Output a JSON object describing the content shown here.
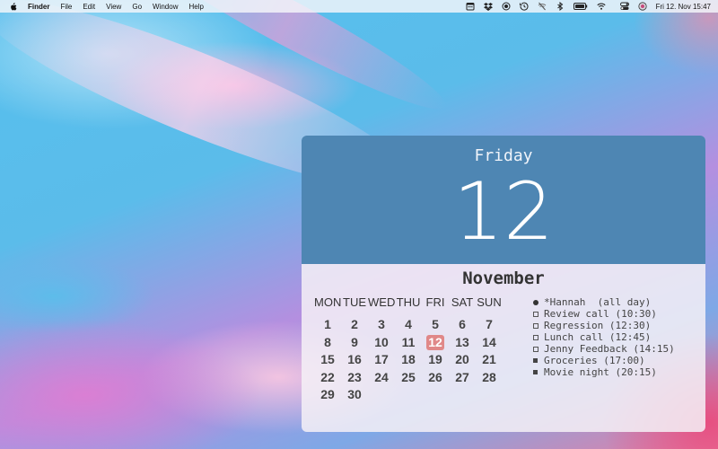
{
  "menubar": {
    "app_name": "Finder",
    "menus": [
      "File",
      "Edit",
      "View",
      "Go",
      "Window",
      "Help"
    ],
    "status_icons": [
      "calendar-icon",
      "dropbox-icon",
      "screen-record-icon",
      "time-machine-icon",
      "wifi-off-icon",
      "bluetooth-icon",
      "battery-icon",
      "wifi-icon",
      "control-center-icon",
      "siri-icon"
    ],
    "clock": "Fri 12. Nov  15:47"
  },
  "widget": {
    "day_name": "Friday",
    "day_number": "12",
    "month": "November",
    "weekdays": [
      "MON",
      "TUE",
      "WED",
      "THU",
      "FRI",
      "SAT",
      "SUN"
    ],
    "days": [
      "1",
      "2",
      "3",
      "4",
      "5",
      "6",
      "7",
      "8",
      "9",
      "10",
      "11",
      "12",
      "13",
      "14",
      "15",
      "16",
      "17",
      "18",
      "19",
      "20",
      "21",
      "22",
      "23",
      "24",
      "25",
      "26",
      "27",
      "28",
      "29",
      "30"
    ],
    "today": "12",
    "colors": {
      "header": "#4e86b3",
      "today": "#e08888"
    },
    "events": [
      {
        "text": "*Hannah  (all day)",
        "marker": "dot"
      },
      {
        "text": "Review call (10:30)",
        "marker": "box"
      },
      {
        "text": "Regression (12:30)",
        "marker": "box"
      },
      {
        "text": "Lunch call (12:45)",
        "marker": "box"
      },
      {
        "text": "Jenny Feedback (14:15)",
        "marker": "box"
      },
      {
        "text": "Groceries (17:00)",
        "marker": "filled"
      },
      {
        "text": "Movie night (20:15)",
        "marker": "filled"
      }
    ]
  }
}
